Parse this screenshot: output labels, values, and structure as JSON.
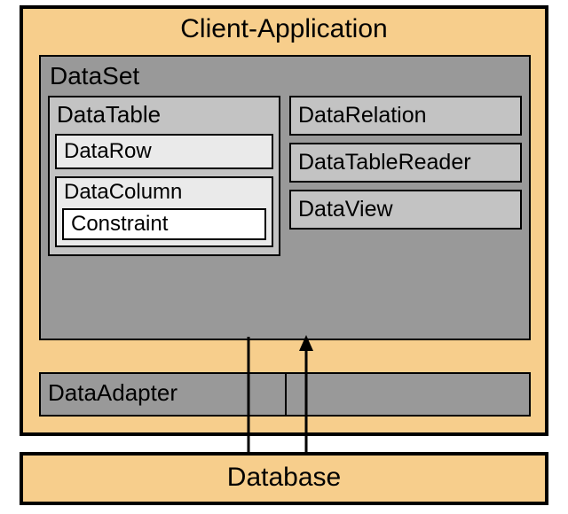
{
  "diagram": {
    "client_app_title": "Client-Application",
    "dataset_title": "DataSet",
    "datatable_title": "DataTable",
    "datarow_label": "DataRow",
    "datacolumn_title": "DataColumn",
    "constraint_label": "Constraint",
    "datarelation_label": "DataRelation",
    "datatablereader_label": "DataTableReader",
    "dataview_label": "DataView",
    "dataadapter_label": "DataAdapter",
    "database_label": "Database"
  }
}
